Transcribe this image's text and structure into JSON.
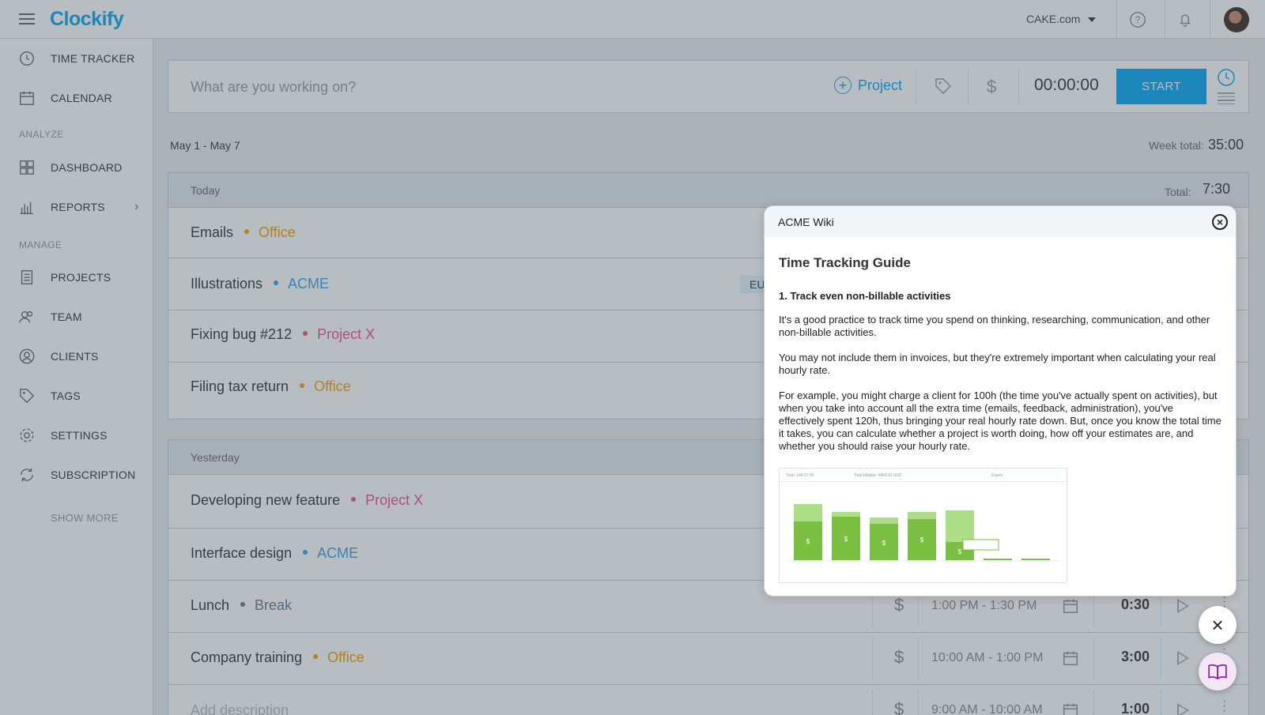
{
  "app": {
    "logo": "Clockify",
    "workspace": "CAKE.com"
  },
  "sidebar": {
    "items": [
      {
        "label": "TIME TRACKER",
        "icon": "clock-icon"
      },
      {
        "label": "CALENDAR",
        "icon": "calendar-icon"
      },
      {
        "label": "DASHBOARD",
        "icon": "dashboard-icon"
      },
      {
        "label": "REPORTS",
        "icon": "bar-chart-icon"
      },
      {
        "label": "PROJECTS",
        "icon": "document-icon"
      },
      {
        "label": "TEAM",
        "icon": "team-icon"
      },
      {
        "label": "CLIENTS",
        "icon": "user-circle-icon"
      },
      {
        "label": "TAGS",
        "icon": "tag-icon"
      },
      {
        "label": "SETTINGS",
        "icon": "gear-icon"
      },
      {
        "label": "SUBSCRIPTION",
        "icon": "refresh-icon"
      }
    ],
    "section_analyze": "ANALYZE",
    "section_manage": "MANAGE",
    "show_more": "SHOW MORE"
  },
  "tracker": {
    "placeholder": "What are you working on?",
    "project_label": "Project",
    "timer": "00:00:00",
    "start_label": "START"
  },
  "week": {
    "range": "May 1 - May 7",
    "total_label": "Week total:",
    "total": "35:00"
  },
  "today": {
    "label": "Today",
    "total_label": "Total:",
    "total": "7:30",
    "entries": [
      {
        "desc": "Emails",
        "project": "Office",
        "color": "#f0a000"
      },
      {
        "desc": "Illustrations",
        "project": "ACME",
        "color": "#2fa4e7",
        "tag": "EU"
      },
      {
        "desc": "Fixing bug #212",
        "project": "Project X",
        "color": "#ea4e8e"
      },
      {
        "desc": "Filing tax return",
        "project": "Office",
        "color": "#f0a000"
      }
    ]
  },
  "yesterday": {
    "label": "Yesterday",
    "entries": [
      {
        "desc": "Developing new feature",
        "project": "Project X",
        "color": "#ea4e8e"
      },
      {
        "desc": "Interface design",
        "project": "ACME",
        "color": "#2fa4e7"
      },
      {
        "desc": "Lunch",
        "project": "Break",
        "color": "#607d8b",
        "range": "1:00 PM - 1:30 PM",
        "duration": "0:30"
      },
      {
        "desc": "Company training",
        "project": "Office",
        "color": "#f0a000",
        "range": "10:00 AM - 1:00 PM",
        "duration": "3:00"
      },
      {
        "desc": "Add description",
        "project": "",
        "color": "",
        "range": "9:00 AM - 10:00 AM",
        "duration": "1:00"
      }
    ]
  },
  "wiki": {
    "title": "ACME Wiki",
    "heading": "Time Tracking Guide",
    "subheading": "1. Track even non-billable activities",
    "p1": "It's a good practice to track time you spend on thinking, researching, communication, and other non-billable activities.",
    "p2": "You may not include them in invoices, but they're extremely important when calculating your real hourly rate.",
    "p3": "For example, you might charge a client for 100h (the time you've actually spent on activities), but when you take into account all the extra time (emails, feedback, administration), you've effectively spent 120h, thus bringing your real hourly rate down. But, once you know the total time it takes, you can calculate whether a project is worth doing, how off your estimates are, and whether you should raise your hourly rate.",
    "chart_caption_total": "Total: 144:27:00",
    "chart_caption_billable": "Total billable: 4464.00 USD",
    "chart_export": "Export"
  }
}
